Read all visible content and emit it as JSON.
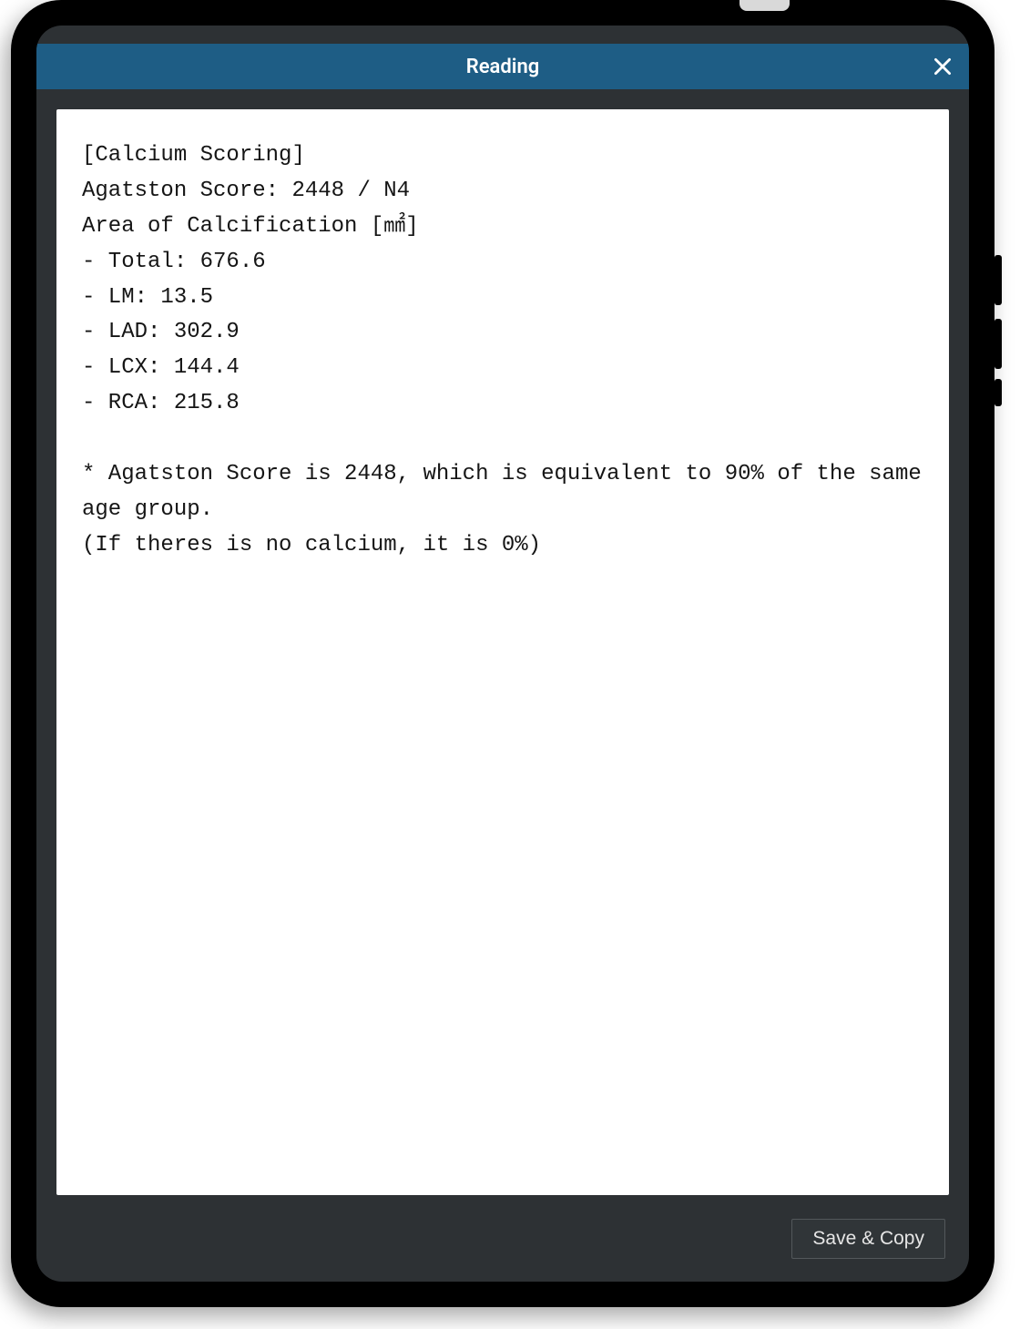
{
  "dialog": {
    "title": "Reading",
    "save_label": "Save & Copy"
  },
  "report": {
    "section": "[Calcium Scoring]",
    "agatston_line": "Agatston Score: 2448 / N4",
    "area_header": "Area of Calcification [㎟]",
    "areas": {
      "total": "- Total: 676.6",
      "lm": "- LM: 13.5",
      "lad": "- LAD: 302.9",
      "lcx": "- LCX: 144.4",
      "rca": "- RCA: 215.8"
    },
    "note1": "* Agatston Score is 2448, which is equivalent to 90% of the same age group.",
    "note2": "(If theres is no calcium, it is 0%)"
  }
}
